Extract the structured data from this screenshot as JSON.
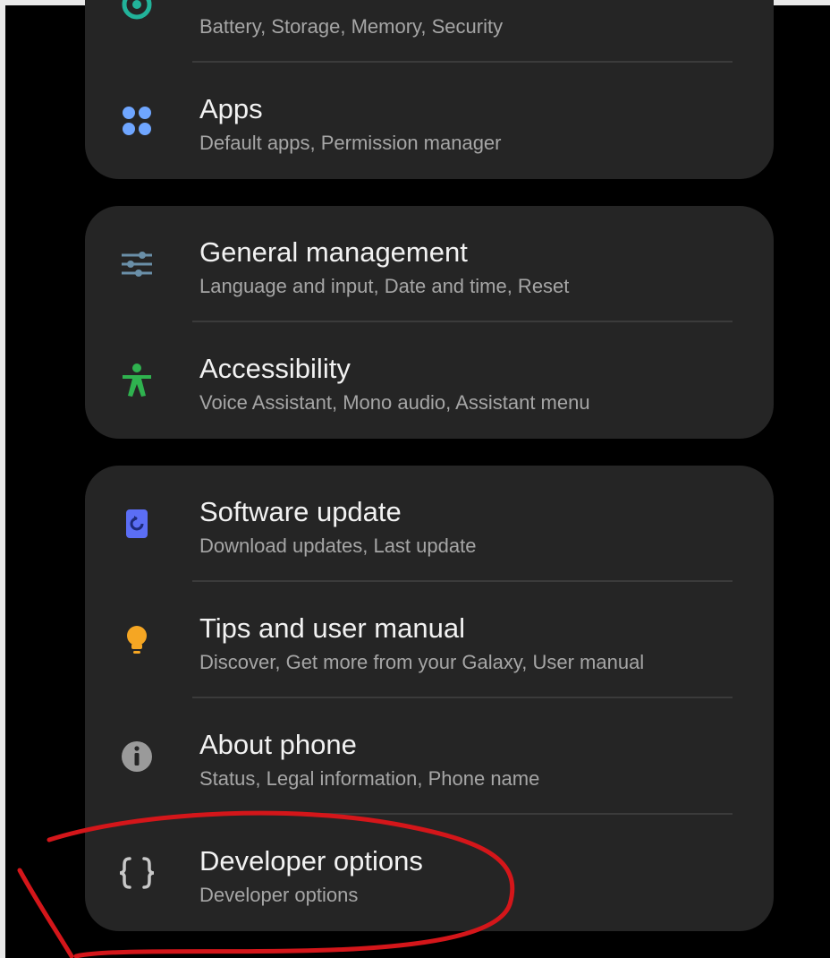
{
  "settings": {
    "cards": [
      {
        "items": [
          {
            "title": "",
            "subtitle": "Battery, Storage, Memory, Security",
            "icon": "device-care-icon",
            "color": "#22b39a"
          },
          {
            "title": "Apps",
            "subtitle": "Default apps, Permission manager",
            "icon": "apps-icon",
            "color": "#6fa6ff"
          }
        ]
      },
      {
        "items": [
          {
            "title": "General management",
            "subtitle": "Language and input, Date and time, Reset",
            "icon": "sliders-icon",
            "color": "#6a8fa8"
          },
          {
            "title": "Accessibility",
            "subtitle": "Voice Assistant, Mono audio, Assistant menu",
            "icon": "accessibility-icon",
            "color": "#2fb24f"
          }
        ]
      },
      {
        "items": [
          {
            "title": "Software update",
            "subtitle": "Download updates, Last update",
            "icon": "software-update-icon",
            "color": "#5b6ef5"
          },
          {
            "title": "Tips and user manual",
            "subtitle": "Discover, Get more from your Galaxy, User manual",
            "icon": "lightbulb-icon",
            "color": "#f5a623"
          },
          {
            "title": "About phone",
            "subtitle": "Status, Legal information, Phone name",
            "icon": "info-icon",
            "color": "#9a9a9a"
          },
          {
            "title": "Developer options",
            "subtitle": "Developer options",
            "icon": "curly-braces-icon",
            "color": "#c8c8c8"
          }
        ]
      }
    ]
  },
  "annotation": {
    "color": "#d4161a"
  }
}
